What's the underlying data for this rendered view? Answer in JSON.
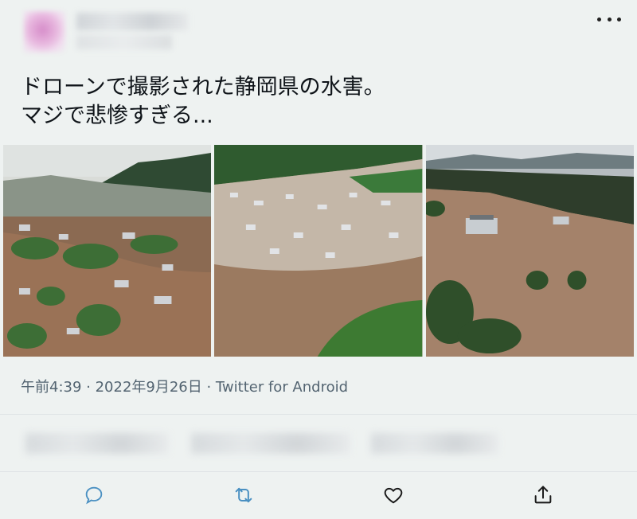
{
  "tweet": {
    "text_line1": "ドローンで撮影された静岡県の水害。",
    "text_line2": "マジで悲惨すぎる...",
    "meta": "午前4:39 · 2022年9月26日 · Twitter for Android"
  },
  "photos": [
    {
      "description_icon": "flooded-town-photo-1"
    },
    {
      "description_icon": "flooded-town-photo-2"
    },
    {
      "description_icon": "flooded-town-photo-3"
    }
  ],
  "actions": {
    "reply_icon": "reply-icon",
    "retweet_icon": "retweet-icon",
    "like_icon": "heart-icon",
    "share_icon": "share-icon"
  },
  "colors": {
    "background": "#eef2f1",
    "meta_text": "#536471",
    "icon_accent": "#4a90c2"
  }
}
